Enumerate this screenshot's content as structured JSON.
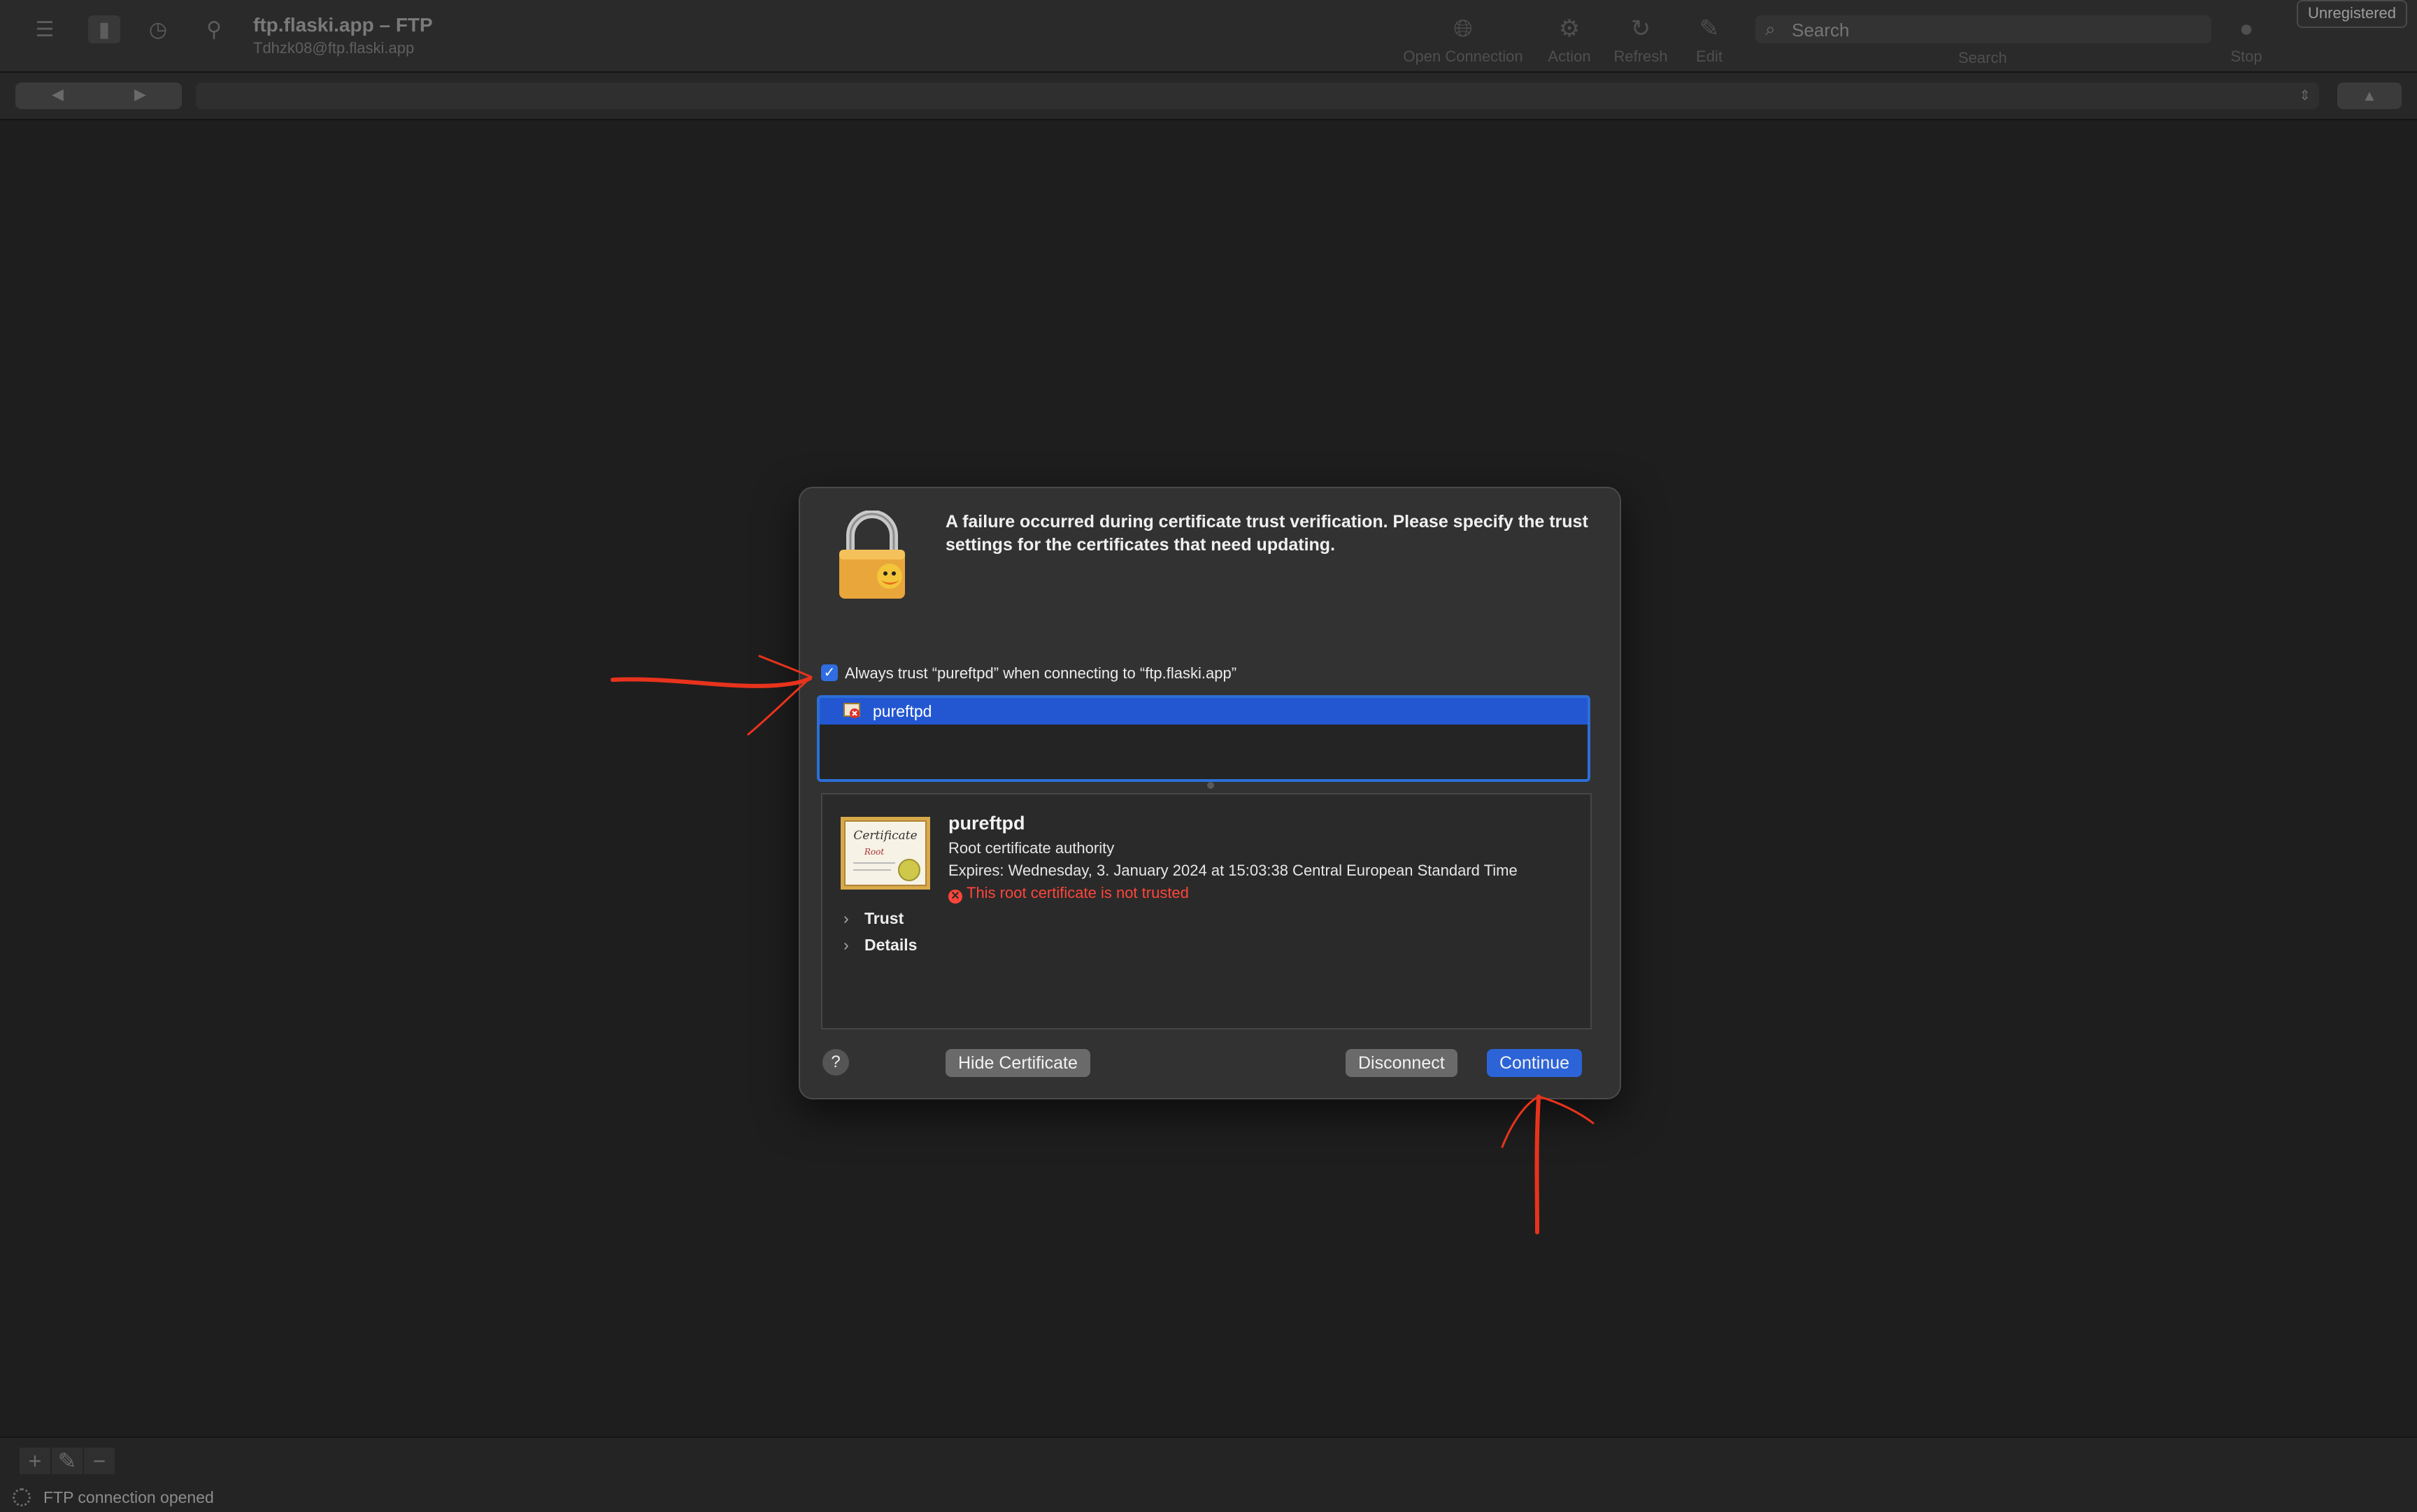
{
  "window": {
    "title": "ftp.flaski.app – FTP",
    "subtitle": "Tdhzk08@ftp.flaski.app",
    "badge": "Unregistered"
  },
  "toolbar": {
    "open_connection": "Open Connection",
    "action": "Action",
    "refresh": "Refresh",
    "edit": "Edit",
    "search_placeholder": "Search",
    "search_label": "Search",
    "stop": "Stop"
  },
  "dialog": {
    "message": "A failure occurred during certificate trust verification. Please specify the trust settings for the certificates that need updating.",
    "always_trust_label": "Always trust “pureftpd” when connecting to “ftp.flaski.app”",
    "always_trust_checked": true,
    "cert_list": [
      "pureftpd"
    ],
    "certificate": {
      "name": "pureftpd",
      "kind": "Root certificate authority",
      "expires": "Expires: Wednesday, 3. January 2024 at 15:03:38 Central European Standard Time",
      "warning": "This root certificate is not trusted",
      "sections": [
        "Trust",
        "Details"
      ]
    },
    "buttons": {
      "help": "?",
      "hide_certificate": "Hide Certificate",
      "disconnect": "Disconnect",
      "continue": "Continue"
    }
  },
  "status": {
    "text": "FTP connection opened"
  },
  "colors": {
    "accent": "#2c64d8",
    "selection": "#2357d2",
    "error": "#ff453a",
    "annotation": "#e8331c"
  }
}
